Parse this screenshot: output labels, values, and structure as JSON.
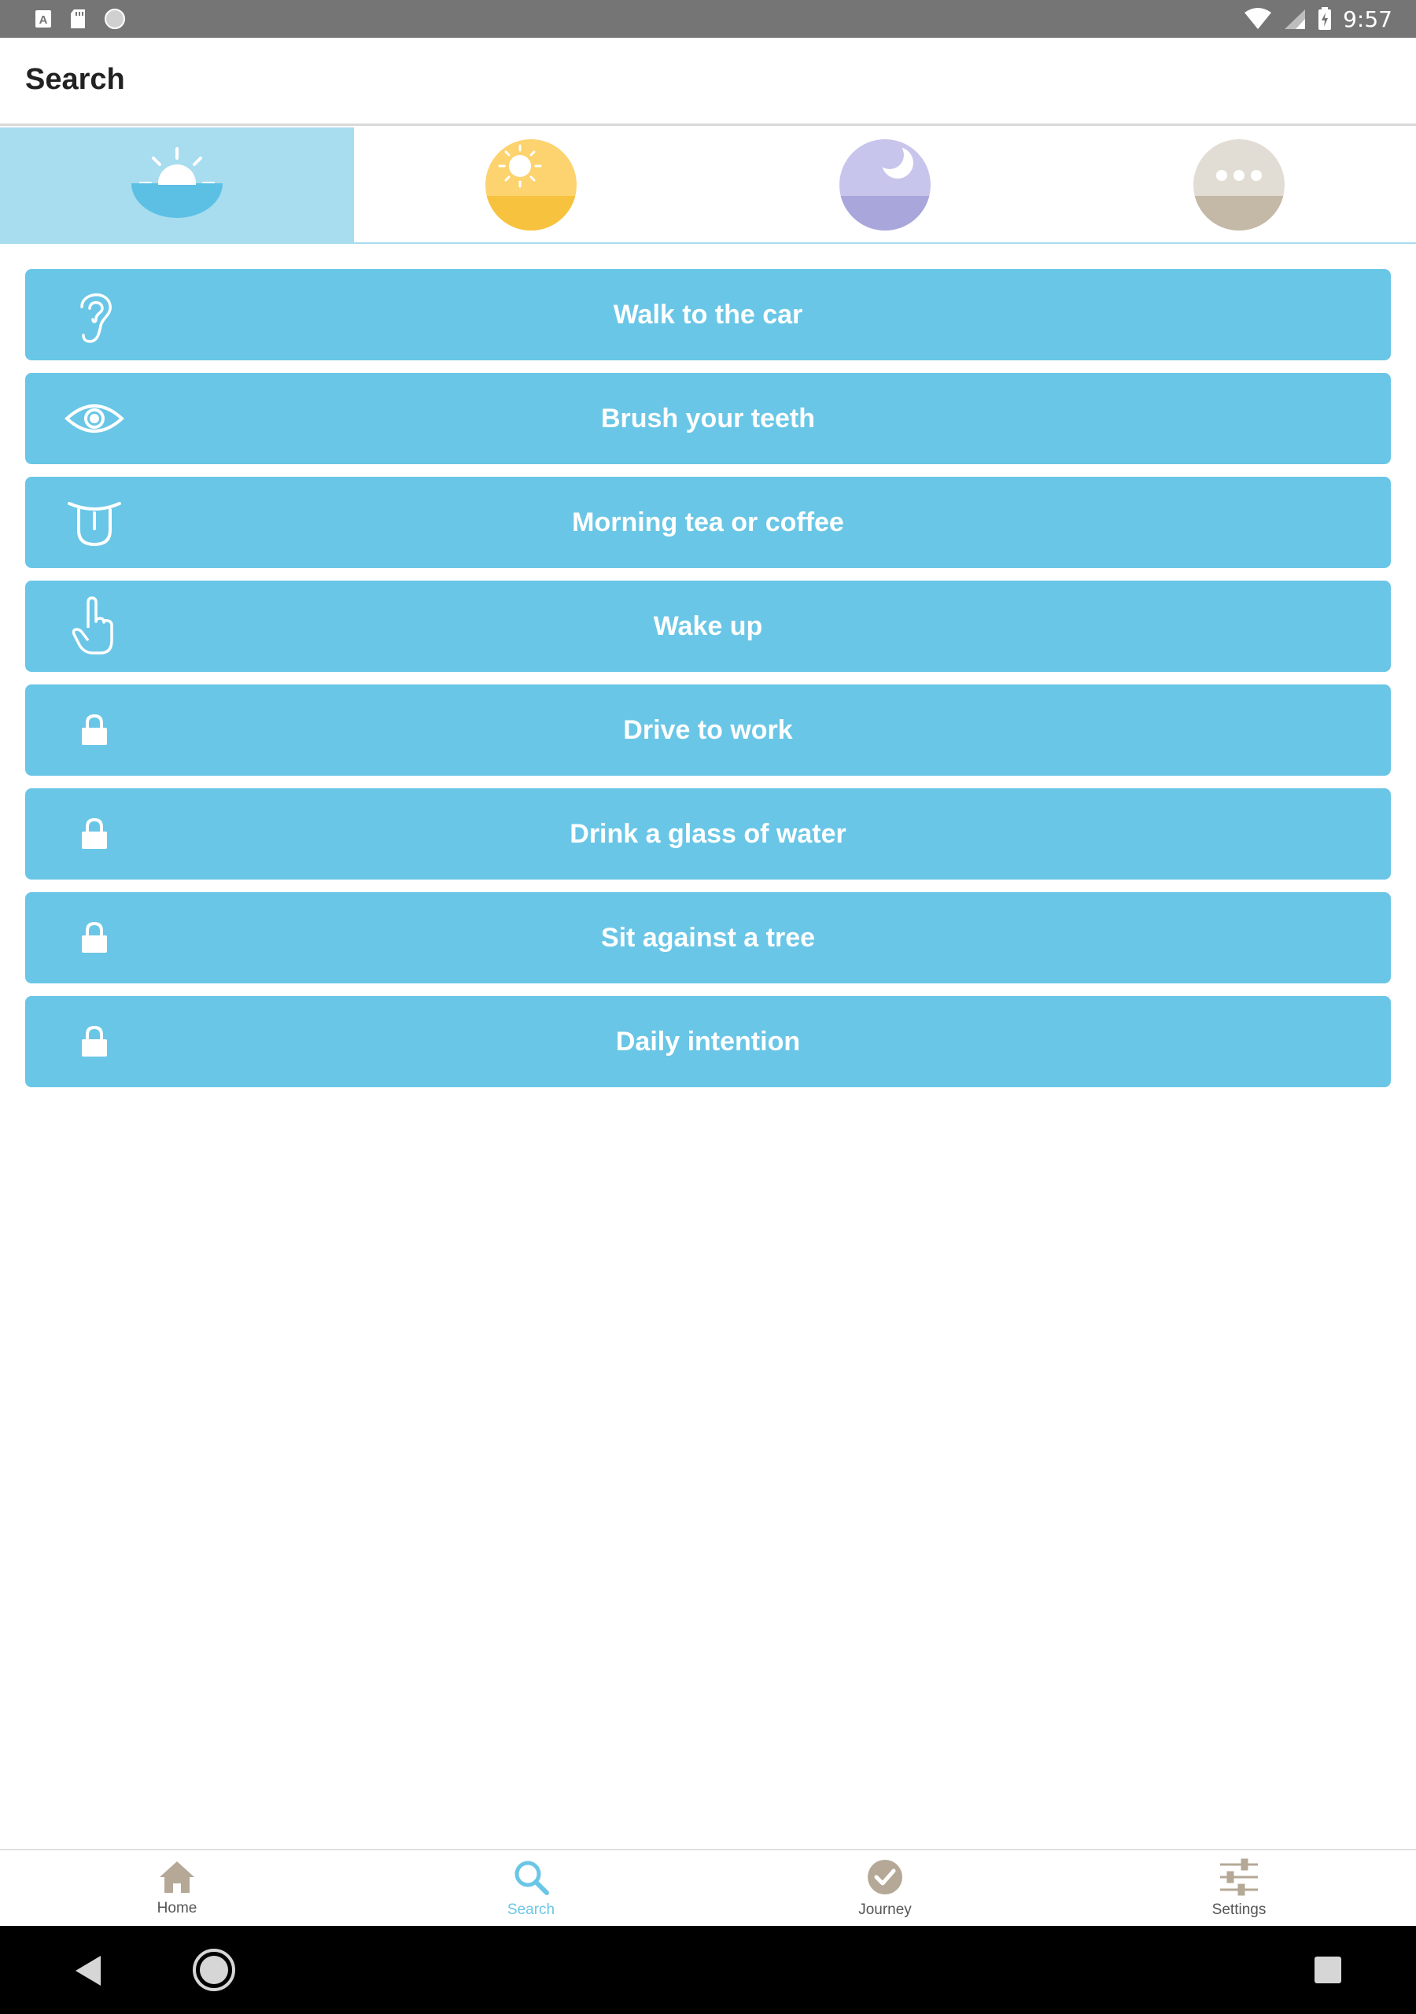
{
  "status_bar": {
    "time": "9:57",
    "left_icons": [
      "a-badge-icon",
      "sd-card-icon",
      "circle-icon"
    ],
    "right_icons": [
      "wifi-icon",
      "signal-icon",
      "battery-icon"
    ]
  },
  "app_bar": {
    "title": "Search"
  },
  "category_tabs": [
    {
      "name": "sunrise",
      "icon": "sunrise-icon",
      "active": true,
      "color": "#5cc0e4"
    },
    {
      "name": "sun",
      "icon": "sun-icon",
      "active": false,
      "color": "#f7c744"
    },
    {
      "name": "moon",
      "icon": "moon-icon",
      "active": false,
      "color": "#a9a6dc"
    },
    {
      "name": "more",
      "icon": "more-icon",
      "active": false,
      "color": "#c4b8a7"
    }
  ],
  "activities": [
    {
      "label": "Walk to the car",
      "icon": "ear-icon",
      "locked": false
    },
    {
      "label": "Brush your teeth",
      "icon": "eye-icon",
      "locked": false
    },
    {
      "label": "Morning tea or coffee",
      "icon": "tongue-icon",
      "locked": false
    },
    {
      "label": "Wake up",
      "icon": "hand-pointer-icon",
      "locked": false
    },
    {
      "label": "Drive to work",
      "icon": "lock-icon",
      "locked": true
    },
    {
      "label": "Drink a glass of water",
      "icon": "lock-icon",
      "locked": true
    },
    {
      "label": "Sit against a tree",
      "icon": "lock-icon",
      "locked": true
    },
    {
      "label": "Daily intention",
      "icon": "lock-icon",
      "locked": true
    }
  ],
  "bottom_nav": [
    {
      "label": "Home",
      "icon": "home-icon",
      "active": false
    },
    {
      "label": "Search",
      "icon": "search-icon",
      "active": true
    },
    {
      "label": "Journey",
      "icon": "check-circle-icon",
      "active": false
    },
    {
      "label": "Settings",
      "icon": "sliders-icon",
      "active": false
    }
  ],
  "colors": {
    "accent": "#6ac6e6",
    "active_tab_bg": "#a8dcef",
    "status_bar": "#757575",
    "nav_icon": "#b5a896"
  }
}
